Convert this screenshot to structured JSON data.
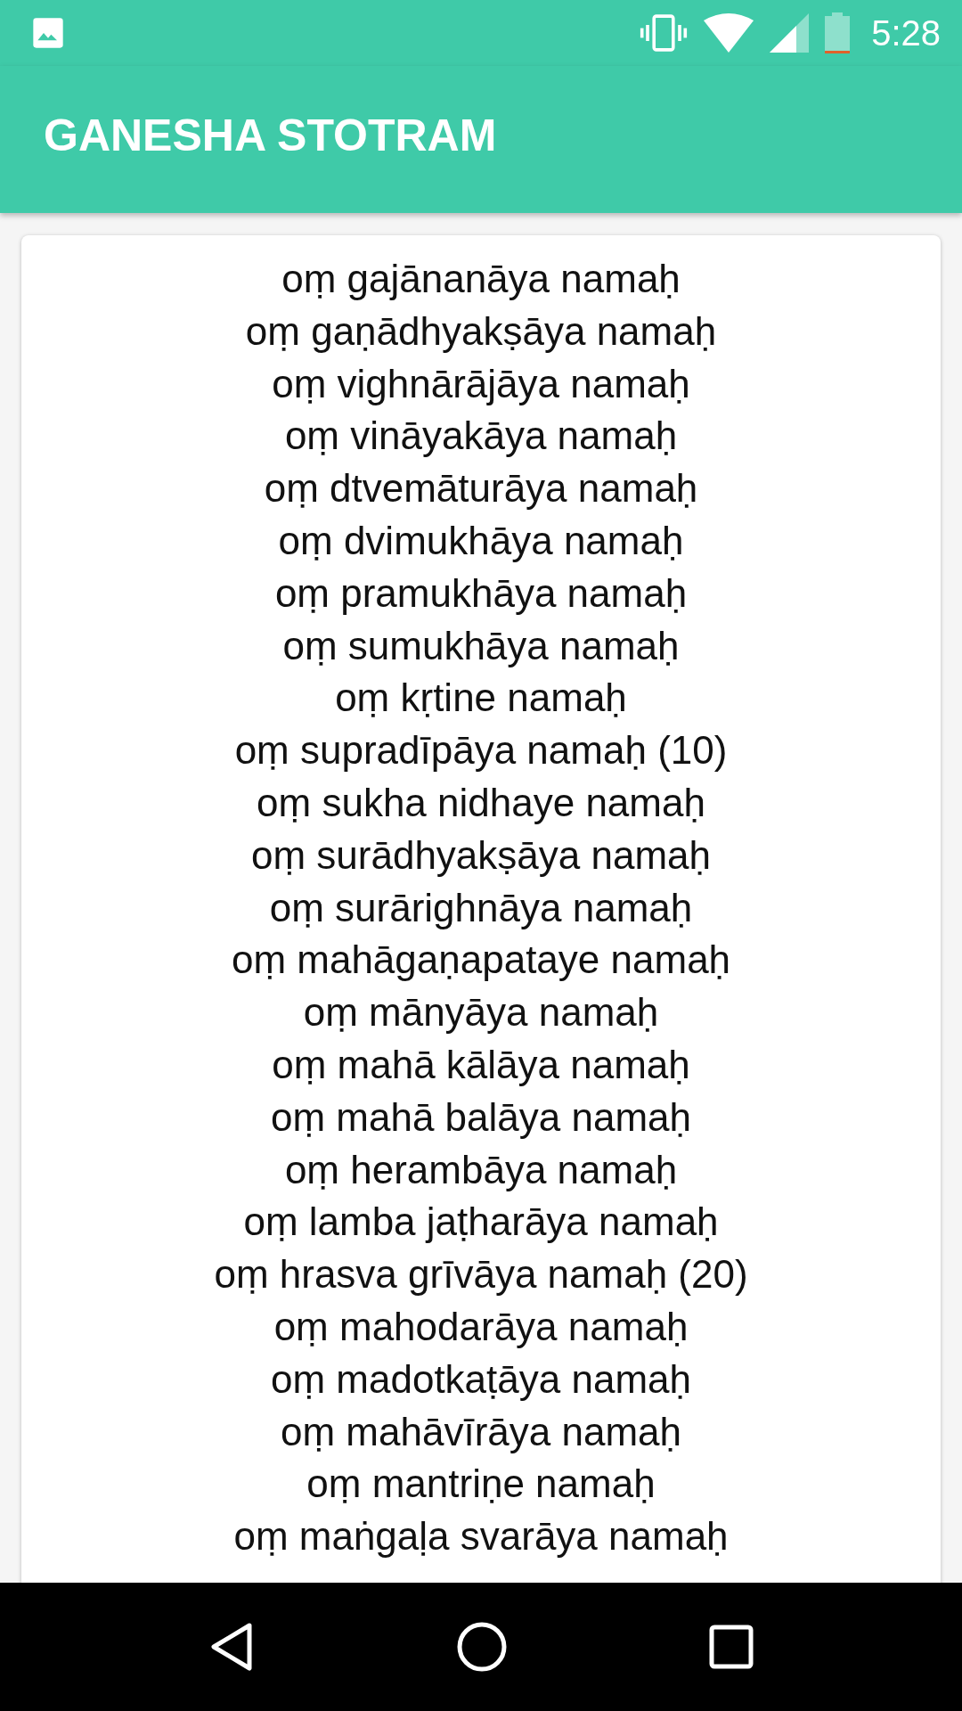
{
  "status_bar": {
    "time": "5:28"
  },
  "app_bar": {
    "title": "GANESHA STOTRAM"
  },
  "verses": [
    "oṃ gajānanāya namaḥ",
    "oṃ gaṇādhyakṣāya namaḥ",
    "oṃ vighnārājāya namaḥ",
    "oṃ vināyakāya namaḥ",
    "oṃ dtvemāturāya namaḥ",
    "oṃ dvimukhāya namaḥ",
    "oṃ pramukhāya namaḥ",
    "oṃ sumukhāya namaḥ",
    "oṃ kṛtine namaḥ",
    "oṃ supradīpāya namaḥ (10)",
    "oṃ sukha nidhaye namaḥ",
    "oṃ surādhyakṣāya namaḥ",
    "oṃ surārighnāya namaḥ",
    "oṃ mahāgaṇapataye namaḥ",
    "oṃ mānyāya namaḥ",
    "oṃ mahā kālāya namaḥ",
    "oṃ mahā balāya namaḥ",
    "oṃ herambāya namaḥ",
    "oṃ lamba jaṭharāya namaḥ",
    "oṃ hrasva grīvāya namaḥ (20)",
    "oṃ mahodarāya namaḥ",
    "oṃ madotkaṭāya namaḥ",
    "oṃ mahāvīrāya namaḥ",
    "oṃ mantriṇe namaḥ",
    "oṃ maṅgaḷa svarāya namaḥ"
  ]
}
